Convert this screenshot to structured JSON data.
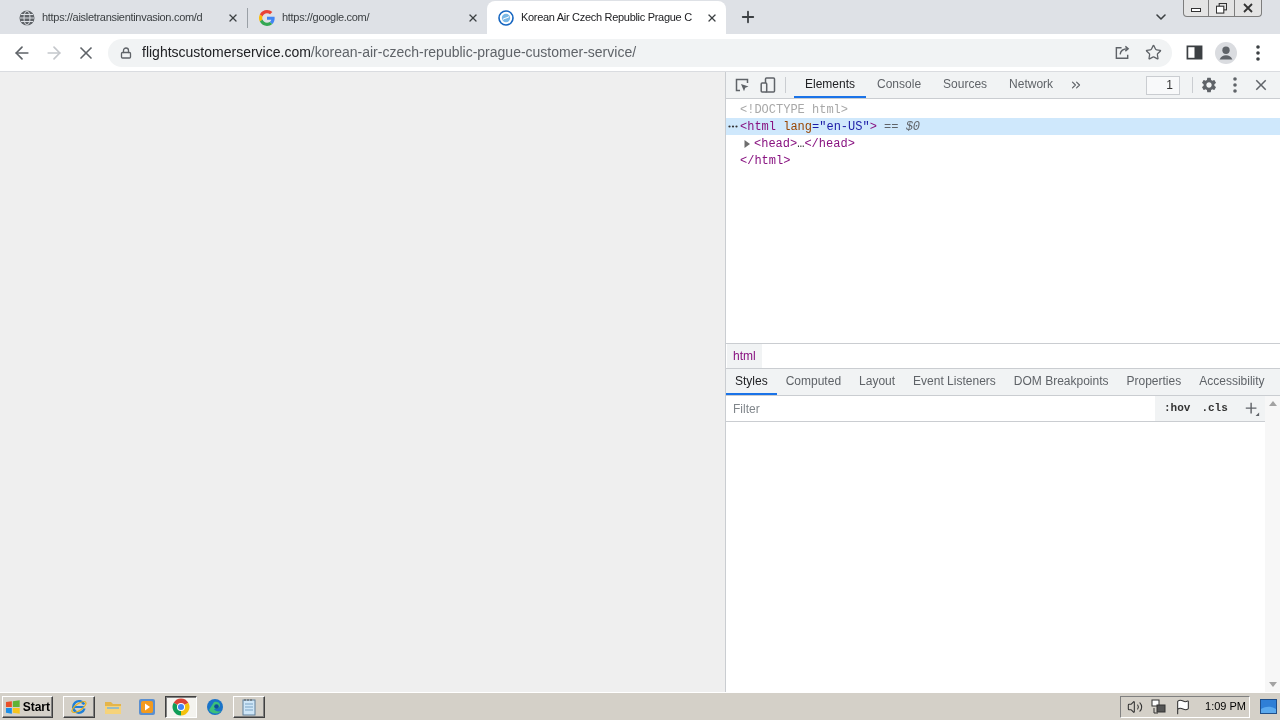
{
  "browser": {
    "tabs": [
      {
        "title": "https://aisletransientinvasion.com/d",
        "selected": false
      },
      {
        "title": "https://google.com/",
        "selected": false
      },
      {
        "title": "Korean Air Czech Republic Prague C",
        "selected": true
      }
    ],
    "toolbar": {
      "forward_disabled": true,
      "loading": true,
      "address": {
        "host": "flightscustomerservice.com",
        "path": "/korean-air-czech-republic-prague-customer-service/"
      }
    }
  },
  "devtools": {
    "tabs": [
      {
        "label": "Elements",
        "selected": true
      },
      {
        "label": "Console",
        "selected": false
      },
      {
        "label": "Sources",
        "selected": false
      },
      {
        "label": "Network",
        "selected": false
      }
    ],
    "counter": "1",
    "dom_tree": [
      {
        "selected": false,
        "segments": [
          {
            "kind": "doctype",
            "text": "<!DOCTYPE html>"
          }
        ]
      },
      {
        "selected": true,
        "segments": [
          {
            "kind": "tag",
            "text": "<html"
          },
          {
            "kind": "attr_name",
            "text": " lang"
          },
          {
            "kind": "punct",
            "text": "="
          },
          {
            "kind": "attr_value",
            "text": "\"en-US\""
          },
          {
            "kind": "tag",
            "text": ">"
          },
          {
            "kind": "marker",
            "text": " == "
          },
          {
            "kind": "console_ref",
            "text": "$0"
          }
        ],
        "children": [
          {
            "selected": false,
            "expanded": false,
            "segments": [
              {
                "kind": "tag",
                "text": "<head>"
              },
              {
                "kind": "ellipsis",
                "text": "…"
              },
              {
                "kind": "tag",
                "text": "</head>"
              }
            ]
          }
        ],
        "closing": [
          {
            "kind": "tag",
            "text": "</html>"
          }
        ]
      }
    ],
    "breadcrumbs": [
      {
        "label": "html",
        "selected": true
      }
    ],
    "sidebar_tabs": [
      {
        "label": "Styles",
        "selected": true
      },
      {
        "label": "Computed",
        "selected": false
      },
      {
        "label": "Layout",
        "selected": false
      },
      {
        "label": "Event Listeners",
        "selected": false
      },
      {
        "label": "DOM Breakpoints",
        "selected": false
      },
      {
        "label": "Properties",
        "selected": false
      },
      {
        "label": "Accessibility",
        "selected": false
      }
    ],
    "filter": {
      "placeholder": "Filter"
    },
    "filter_buttons": [
      ":hov",
      ".cls"
    ]
  },
  "taskbar": {
    "start": "Start",
    "apps": [
      {
        "kind": "window",
        "selected": false
      },
      {
        "kind": "launcher",
        "selected": false
      },
      {
        "kind": "launcher",
        "selected": false
      },
      {
        "kind": "window",
        "selected": true
      },
      {
        "kind": "launcher",
        "selected": false
      },
      {
        "kind": "window",
        "selected": false
      }
    ],
    "clock": "1:09 PM"
  }
}
